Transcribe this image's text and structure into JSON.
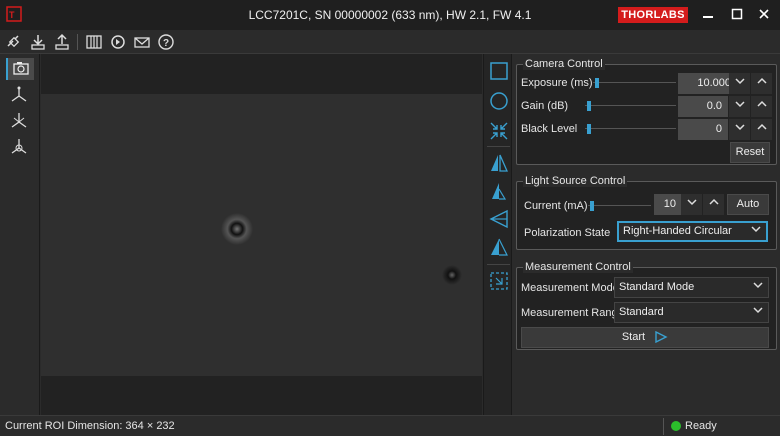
{
  "window": {
    "title": "LCC7201C, SN 00000002 (633 nm), HW 2.1, FW 4.1",
    "brand": "THORLABS",
    "minimize_icon": "minimize-icon",
    "maximize_icon": "maximize-icon",
    "close_icon": "close-icon"
  },
  "toolbar": {
    "buttons": [
      {
        "name": "connect-icon"
      },
      {
        "name": "download-icon"
      },
      {
        "name": "upload-icon"
      },
      {
        "name": "grid-icon"
      },
      {
        "name": "refresh-icon"
      },
      {
        "name": "mail-icon"
      },
      {
        "name": "help-icon"
      }
    ]
  },
  "sidebar": {
    "items": [
      {
        "name": "camera-icon",
        "active": true
      },
      {
        "name": "axes-icon-1",
        "active": false
      },
      {
        "name": "axes-icon-2",
        "active": false
      },
      {
        "name": "axes-icon-3",
        "active": false
      }
    ]
  },
  "camera_control": {
    "title": "Camera Control",
    "exposure": {
      "label": "Exposure (ms)",
      "value": "10.000"
    },
    "gain": {
      "label": "Gain (dB)",
      "value": "0.0"
    },
    "black_level": {
      "label": "Black Level",
      "value": "0"
    },
    "reset_label": "Reset"
  },
  "light_source_control": {
    "title": "Light Source Control",
    "current": {
      "label": "Current (mA)",
      "value": "10"
    },
    "auto_label": "Auto",
    "polarization": {
      "label": "Polarization State",
      "value": "Right-Handed Circular"
    }
  },
  "measurement_control": {
    "title": "Measurement Control",
    "mode": {
      "label": "Measurement Mode",
      "value": "Standard Mode"
    },
    "range": {
      "label": "Measurement Range",
      "value": "Standard"
    },
    "start_label": "Start"
  },
  "status": {
    "roi": "Current ROI Dimension: 364 × 232",
    "state": "Ready"
  },
  "colors": {
    "accent": "#39a0d0",
    "brand": "#d41c1c",
    "ready": "#2bbf2b"
  }
}
